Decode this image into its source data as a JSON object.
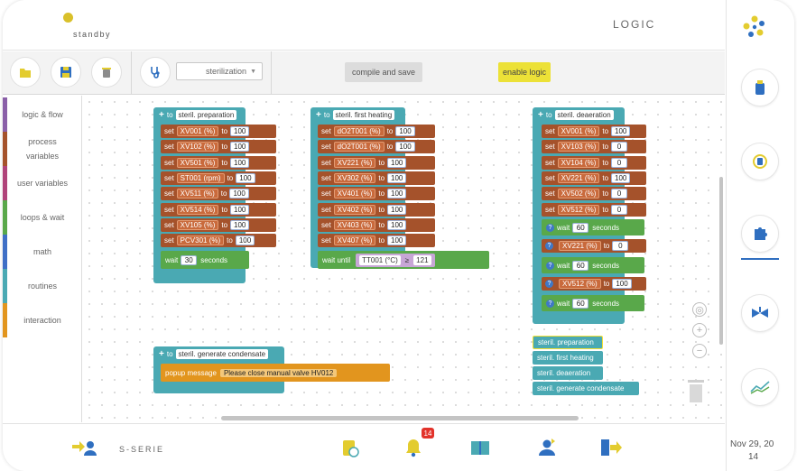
{
  "header": {
    "status": "standby",
    "title": "LOGIC",
    "status_color": "#d9c02a"
  },
  "toolbar": {
    "routine_selected": "sterilization",
    "compile_label": "compile and save",
    "enable_label": "enable logic"
  },
  "categories": [
    {
      "label": "logic & flow",
      "color": "#8a5fa8"
    },
    {
      "label": "process variables",
      "color": "#a5522b"
    },
    {
      "label": "user variables",
      "color": "#b0437a"
    },
    {
      "label": "loops & wait",
      "color": "#59a84a"
    },
    {
      "label": "math",
      "color": "#3f6fc6"
    },
    {
      "label": "routines",
      "color": "#4aa9b3"
    },
    {
      "label": "interaction",
      "color": "#e2951e"
    }
  ],
  "workspace": {
    "to": "to",
    "set": "set",
    "wait": "wait",
    "seconds": "seconds",
    "wait_until": "wait until",
    "popup": "popup message",
    "procedures": {
      "preparation": {
        "name": "steril. preparation",
        "rows": [
          {
            "var": "XV001 (%)",
            "value": "100"
          },
          {
            "var": "XV102 (%)",
            "value": "100"
          },
          {
            "var": "XV501 (%)",
            "value": "100"
          },
          {
            "var": "ST001 (rpm)",
            "value": "100"
          },
          {
            "var": "XV511 (%)",
            "value": "100"
          },
          {
            "var": "XV514 (%)",
            "value": "100"
          },
          {
            "var": "XV105 (%)",
            "value": "100"
          },
          {
            "var": "PCV301 (%)",
            "value": "100"
          }
        ],
        "wait_value": "30"
      },
      "first_heating": {
        "name": "steril. first heating",
        "rows": [
          {
            "var": "dO2T001 (%)",
            "value": "100"
          },
          {
            "var": "dO2T001 (%)",
            "value": "100"
          },
          {
            "var": "XV221 (%)",
            "value": "100"
          },
          {
            "var": "XV302 (%)",
            "value": "100"
          },
          {
            "var": "XV401 (%)",
            "value": "100"
          },
          {
            "var": "XV402 (%)",
            "value": "100"
          },
          {
            "var": "XV403 (%)",
            "value": "100"
          },
          {
            "var": "XV407 (%)",
            "value": "100"
          }
        ],
        "until_var": "TT001 (°C)",
        "until_op": "≥",
        "until_value": "121"
      },
      "deaeration": {
        "name": "steril. deaeration",
        "rows": [
          {
            "var": "XV001 (%)",
            "value": "100"
          },
          {
            "var": "XV103 (%)",
            "value": "0"
          },
          {
            "var": "XV104 (%)",
            "value": "0"
          },
          {
            "var": "XV221 (%)",
            "value": "100"
          },
          {
            "var": "XV502 (%)",
            "value": "0"
          },
          {
            "var": "XV512 (%)",
            "value": "0"
          }
        ],
        "wait1": "60",
        "row7": {
          "var": "XV221 (%)",
          "value": "0"
        },
        "wait2": "60",
        "row8": {
          "var": "XV512 (%)",
          "value": "100"
        },
        "wait3": "60"
      },
      "condensate": {
        "name": "steril. generate condensate",
        "message": "Please close manual valve HV012"
      }
    },
    "calls": [
      "steril. preparation",
      "steril. first heating",
      "steril. deaeration",
      "steril. generate condensate"
    ]
  },
  "right_panel": {
    "datetime_line1": "Nov 29, 20",
    "datetime_line2": "14"
  },
  "footer": {
    "brand": "S-SERIE",
    "alarm_count": "14"
  }
}
